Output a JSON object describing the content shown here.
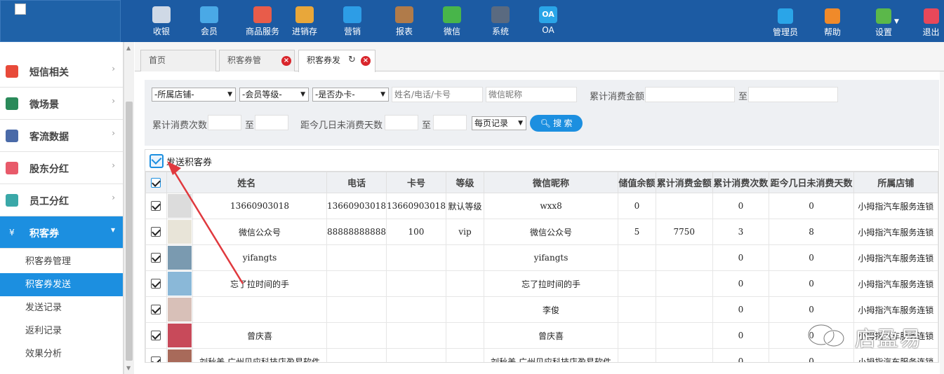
{
  "nav": [
    {
      "label": "收银",
      "color": "#cfd9e6"
    },
    {
      "label": "会员",
      "color": "#4aa9e6"
    },
    {
      "label": "商品服务",
      "color": "#e85c4a"
    },
    {
      "label": "进销存",
      "color": "#e8a73a"
    },
    {
      "label": "营销",
      "color": "#2d9de6"
    },
    {
      "label": "报表",
      "color": "#b07b4a"
    },
    {
      "label": "微信",
      "color": "#48b54a"
    },
    {
      "label": "系统",
      "color": "#5a6a80"
    },
    {
      "label": "OA",
      "color": "#2aa5e8",
      "icon_text": "OA"
    }
  ],
  "right_nav": [
    {
      "label": "管理员",
      "color": "#2aa5e8"
    },
    {
      "label": "帮助",
      "color": "#f08a2a"
    },
    {
      "label": "设置",
      "color": "#5bb84a"
    },
    {
      "label": "退出",
      "color": "#e8485a"
    }
  ],
  "sidebar": {
    "items": [
      {
        "label": "短信相关",
        "arrow": "›",
        "color": "#e84a3a"
      },
      {
        "label": "微场景",
        "arrow": "›",
        "color": "#2a8a5a"
      },
      {
        "label": "客流数据",
        "arrow": "›",
        "color": "#4a6aa8"
      },
      {
        "label": "股东分红",
        "arrow": "›",
        "color": "#e85a6a"
      },
      {
        "label": "员工分红",
        "arrow": "›",
        "color": "#3aa8a8"
      },
      {
        "label": "积客券",
        "arrow": "▾",
        "color": "#1c8fe0",
        "icon_text": "¥"
      }
    ],
    "sub_items": [
      "积客券管理",
      "积客券发送",
      "发送记录",
      "返利记录",
      "效果分析"
    ]
  },
  "tabs": [
    {
      "label": "首页"
    },
    {
      "label": "积客券管"
    },
    {
      "label": "积客券发"
    }
  ],
  "filters": {
    "store_select": "-所属店铺-",
    "level_select": "-会员等级-",
    "card_select": "-是否办卡-",
    "name_placeholder": "姓名/电话/卡号",
    "wechat_placeholder": "微信昵称",
    "total_amount_label": "累计消费金额",
    "to_label": "至",
    "total_count_label": "累计消费次数",
    "days_label": "距今几日未消费天数",
    "page_select": "每页记录",
    "search_label": "搜 索"
  },
  "toolbar": {
    "send_label": "发送积客券"
  },
  "table": {
    "headers": [
      "姓名",
      "电话",
      "卡号",
      "等级",
      "微信昵称",
      "储值余额",
      "累计消费金额",
      "累计消费次数",
      "距今几日未消费天数",
      "所属店铺"
    ],
    "rows": [
      {
        "name": "13660903018",
        "phone": "13660903018",
        "card": "13660903018",
        "level": "默认等级",
        "wechat": "wxx8",
        "balance": "0",
        "amount": "",
        "count": "0",
        "days": "0",
        "store": "小拇指汽车服务连锁",
        "avatar_color": "#dcdcdc"
      },
      {
        "name": "微信公众号",
        "phone": "88888888888",
        "card": "100",
        "level": "vip",
        "wechat": "微信公众号",
        "balance": "5",
        "amount": "7750",
        "count": "3",
        "days": "8",
        "store": "小拇指汽车服务连锁",
        "avatar_color": "#e8e4d8"
      },
      {
        "name": "yifangts",
        "phone": "",
        "card": "",
        "level": "",
        "wechat": "yifangts",
        "balance": "",
        "amount": "",
        "count": "0",
        "days": "0",
        "store": "小拇指汽车服务连锁",
        "avatar_color": "#7a9ab0"
      },
      {
        "name": "忘了拉时间的手",
        "phone": "",
        "card": "",
        "level": "",
        "wechat": "忘了拉时间的手",
        "balance": "",
        "amount": "",
        "count": "0",
        "days": "0",
        "store": "小拇指汽车服务连锁",
        "avatar_color": "#8ab8d8"
      },
      {
        "name": "",
        "phone": "",
        "card": "",
        "level": "",
        "wechat": "李俊",
        "balance": "",
        "amount": "",
        "count": "0",
        "days": "0",
        "store": "小拇指汽车服务连锁",
        "avatar_color": "#d8c0b8"
      },
      {
        "name": "曾庆喜",
        "phone": "",
        "card": "",
        "level": "",
        "wechat": "曾庆喜",
        "balance": "",
        "amount": "",
        "count": "0",
        "days": "0",
        "store": "小拇指汽车服务连锁",
        "avatar_color": "#c84a5a"
      },
      {
        "name": "刘秋美 广州贝应科技店盈易软件",
        "phone": "",
        "card": "",
        "level": "",
        "wechat": "刘秋美 广州贝应科技店盈易软件",
        "balance": "",
        "amount": "",
        "count": "0",
        "days": "0",
        "store": "小拇指汽车服务连锁",
        "avatar_color": "#a86a5a"
      }
    ]
  },
  "watermark": {
    "text": "店盈易"
  }
}
